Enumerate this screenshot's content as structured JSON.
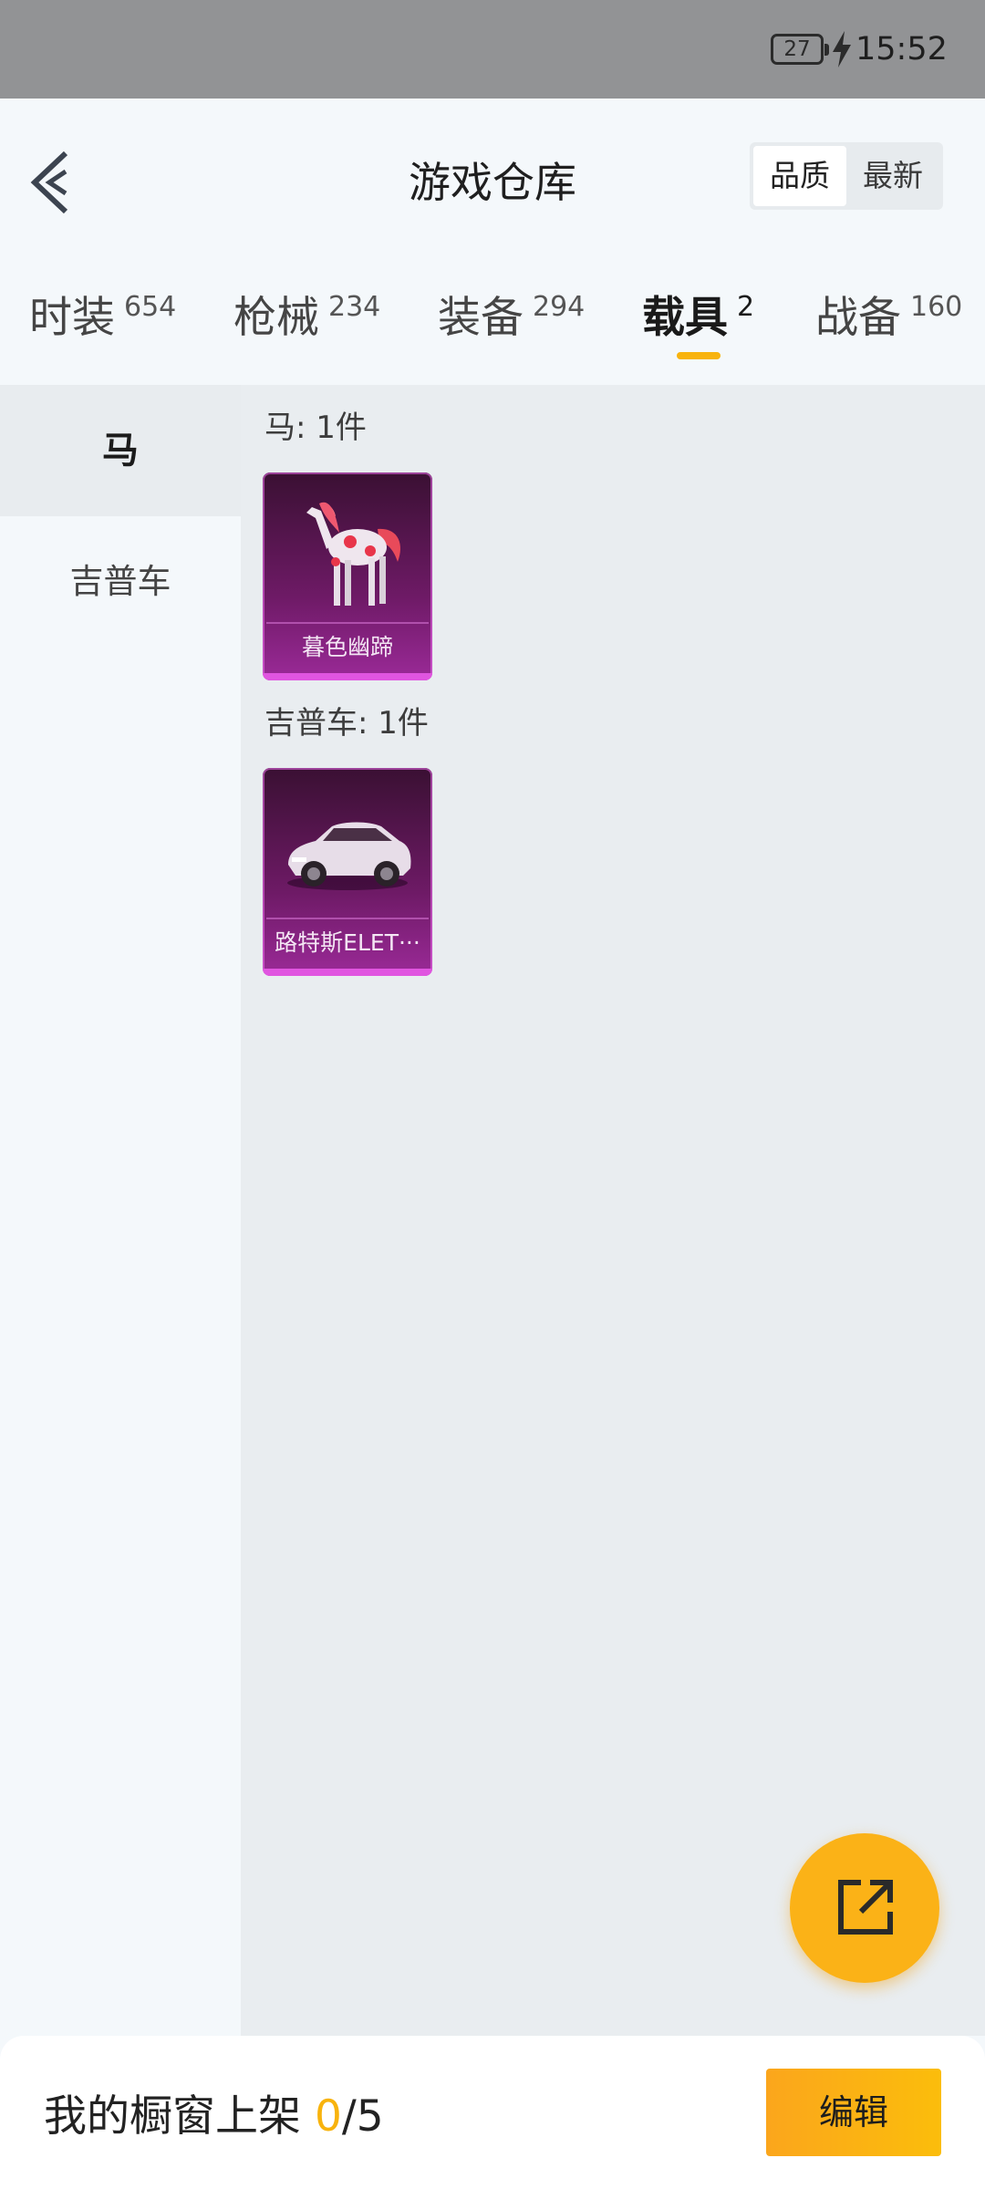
{
  "status_bar": {
    "battery": "27",
    "time": "15:52"
  },
  "header": {
    "title": "游戏仓库",
    "sort_options": [
      "品质",
      "最新"
    ],
    "sort_active": "品质"
  },
  "tabs": [
    {
      "label": "时装",
      "count": "654"
    },
    {
      "label": "枪械",
      "count": "234"
    },
    {
      "label": "装备",
      "count": "294"
    },
    {
      "label": "载具",
      "count": "2",
      "active": true
    },
    {
      "label": "战备",
      "count": "160"
    }
  ],
  "sidebar": {
    "items": [
      {
        "label": "马",
        "active": true
      },
      {
        "label": "吉普车"
      }
    ]
  },
  "sections": [
    {
      "title": "马: 1件",
      "items": [
        {
          "name": "暮色幽蹄",
          "icon": "horse-icon"
        }
      ]
    },
    {
      "title": "吉普车: 1件",
      "items": [
        {
          "name": "路特斯ELET···",
          "icon": "car-icon"
        }
      ]
    }
  ],
  "footer": {
    "showcase_label": "我的橱窗上架",
    "used": "0",
    "total": "/5",
    "edit_label": "编辑"
  },
  "colors": {
    "accent": "#f8b30d",
    "card_purple": "#6e1a66",
    "status_bar": "#929395"
  }
}
